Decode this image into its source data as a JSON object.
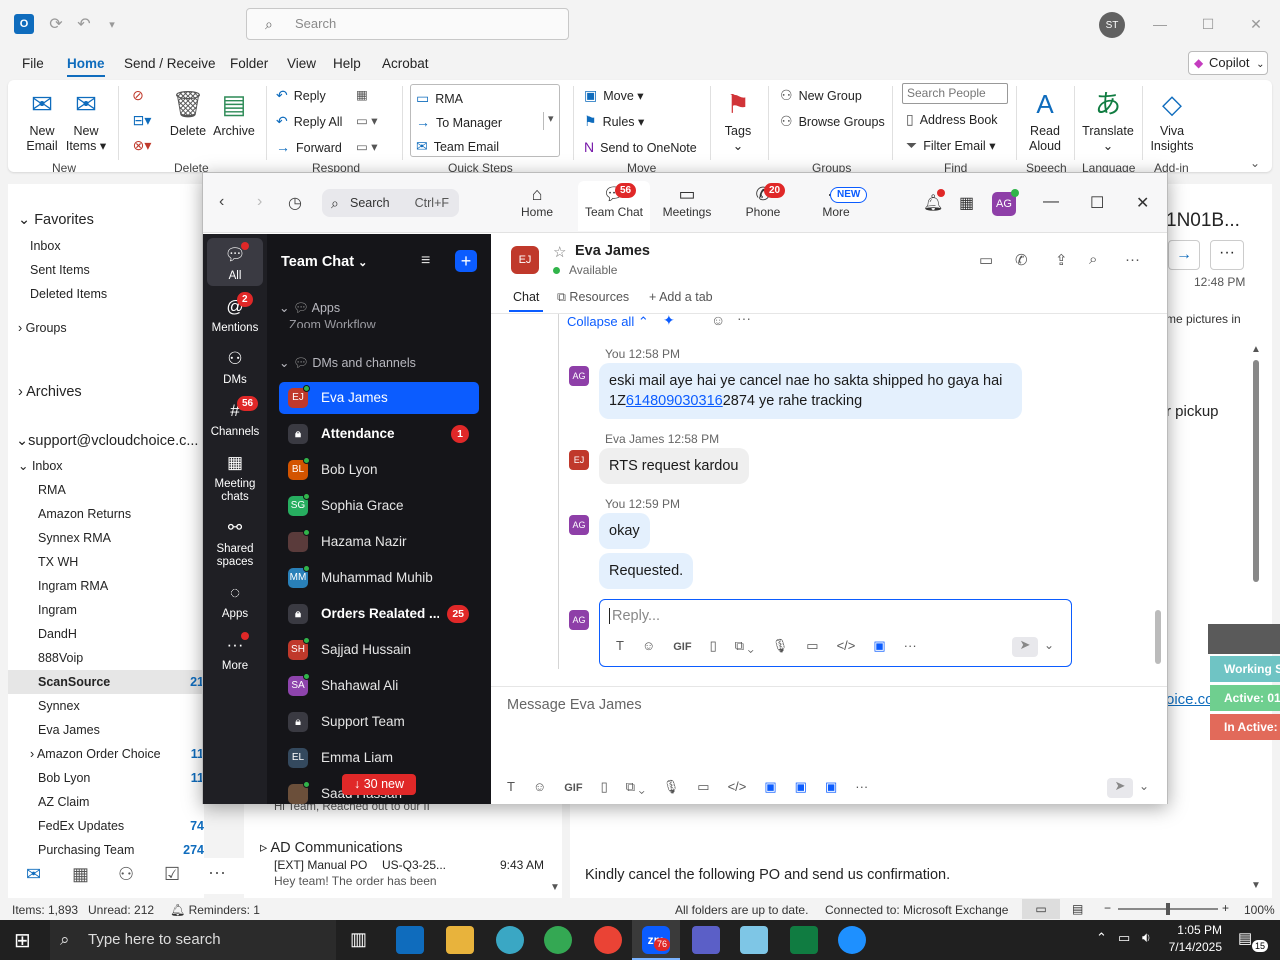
{
  "outlook": {
    "search_placeholder": "Search",
    "user_initials": "ST",
    "menu_tabs": [
      "File",
      "Home",
      "Send / Receive",
      "Folder",
      "View",
      "Help",
      "Acrobat"
    ],
    "copilot_label": "Copilot",
    "ribbon": {
      "new_email": [
        "New",
        "Email"
      ],
      "new_items": [
        "New",
        "Items"
      ],
      "delete": "Delete",
      "archive": "Archive",
      "reply": "Reply",
      "reply_all": "Reply All",
      "forward": "Forward",
      "qs_rma": "RMA",
      "qs_to_manager": "To Manager",
      "qs_team_email": "Team Email",
      "move": "Move",
      "rules": "Rules",
      "send_onenote": "Send to OneNote",
      "tags": "Tags",
      "new_group": "New Group",
      "browse_groups": "Browse Groups",
      "search_people": "Search People",
      "address_book": "Address Book",
      "filter_email": "Filter Email",
      "read_aloud": [
        "Read",
        "Aloud"
      ],
      "translate": "Translate",
      "viva": [
        "Viva",
        "Insights"
      ],
      "groups": [
        "New",
        "Delete",
        "Respond",
        "Quick Steps",
        "Move",
        "Groups",
        "Find",
        "Speech",
        "Language",
        "Add-in"
      ]
    },
    "folders": {
      "favorites": "Favorites",
      "fav_items": [
        "Inbox",
        "Sent Items",
        "Deleted Items"
      ],
      "groups": "Groups",
      "archives": "Archives",
      "account": "support@vcloudchoice.c...",
      "inbox": "Inbox",
      "inbox_items": [
        {
          "name": "RMA",
          "count": ""
        },
        {
          "name": "Amazon Returns",
          "count": ""
        },
        {
          "name": "Synnex RMA",
          "count": ""
        },
        {
          "name": "TX WH",
          "count": ""
        },
        {
          "name": "Ingram RMA",
          "count": ""
        },
        {
          "name": "Ingram",
          "count": ""
        },
        {
          "name": "DandH",
          "count": ""
        },
        {
          "name": "888Voip",
          "count": ""
        },
        {
          "name": "ScanSource",
          "count": "21"
        },
        {
          "name": "Synnex",
          "count": ""
        },
        {
          "name": "Eva James",
          "count": ""
        },
        {
          "name": "Amazon Order Choice",
          "count": "11"
        },
        {
          "name": "Bob Lyon",
          "count": "11"
        },
        {
          "name": "AZ Claim",
          "count": ""
        },
        {
          "name": "FedEx Updates",
          "count": "74"
        },
        {
          "name": "Purchasing Team",
          "count": "274"
        }
      ]
    },
    "message_list": {
      "preview1": "Hi Team,   Reached out to our II",
      "group": "AD Communications",
      "item2_subject": "[EXT] Manual PO",
      "item2_code": "US-Q3-25...",
      "item2_time": "9:43 AM",
      "item2_preview": "Hey team!  The order has been"
    },
    "reading": {
      "code_fragment": "1N01B...",
      "time": "12:48 PM",
      "pictures_note": "me pictures in",
      "pickup": "r pickup",
      "link_fragment": "oice.com",
      "body_fragment": "Kindly cancel the following PO and send us confirmation.",
      "status_working": "Working S",
      "status_active": "Active: 01",
      "status_inactive": "In Active:"
    },
    "status": {
      "items": "Items: 1,893",
      "unread": "Unread: 212",
      "reminders": "Reminders: 1",
      "sync": "All folders are up to date.",
      "connected": "Connected to: Microsoft Exchange",
      "zoom": "100%"
    }
  },
  "taskbar": {
    "search_placeholder": "Type here to search",
    "time": "1:05 PM",
    "date": "7/14/2025",
    "zoom_badge": "76",
    "notif_count": "15"
  },
  "zoom": {
    "search_label": "Search",
    "search_shortcut": "Ctrl+F",
    "tabs": [
      {
        "label": "Home",
        "badge": ""
      },
      {
        "label": "Team Chat",
        "badge": "56"
      },
      {
        "label": "Meetings",
        "badge": ""
      },
      {
        "label": "Phone",
        "badge": "20"
      },
      {
        "label": "More",
        "badge": "NEW"
      }
    ],
    "avatar_initials": "AG",
    "rail": [
      {
        "label": "All",
        "badge": ""
      },
      {
        "label": "Mentions",
        "badge": "2"
      },
      {
        "label": "DMs",
        "badge": ""
      },
      {
        "label": "Channels",
        "badge": "56"
      },
      {
        "label": "Meeting chats",
        "badge": ""
      },
      {
        "label": "Shared spaces",
        "badge": ""
      },
      {
        "label": "Apps",
        "badge": ""
      },
      {
        "label": "More",
        "badge": ""
      }
    ],
    "list_title": "Team Chat",
    "apps_section": "Apps",
    "apps_cut_item": "Zoom Workflow",
    "dm_section": "DMs and channels",
    "contacts": [
      {
        "initials": "EJ",
        "name": "Eva James",
        "color": "#c0392b",
        "count": "",
        "bold": false,
        "locked": false,
        "online": true
      },
      {
        "initials": "",
        "name": "Attendance",
        "color": "#3a3a42",
        "count": "1",
        "bold": true,
        "locked": true,
        "online": false
      },
      {
        "initials": "BL",
        "name": "Bob Lyon",
        "color": "#d35400",
        "count": "",
        "bold": false,
        "locked": false,
        "online": true
      },
      {
        "initials": "SG",
        "name": "Sophia Grace",
        "color": "#27ae60",
        "count": "",
        "bold": false,
        "locked": false,
        "online": true
      },
      {
        "initials": "",
        "name": "Hazama Nazir",
        "color": "#5a3b3b",
        "count": "",
        "bold": false,
        "locked": false,
        "online": true
      },
      {
        "initials": "MM",
        "name": "Muhammad Muhib",
        "color": "#2980b9",
        "count": "",
        "bold": false,
        "locked": false,
        "online": true
      },
      {
        "initials": "",
        "name": "Orders Realated ...",
        "color": "#3a3a42",
        "count": "25",
        "bold": true,
        "locked": true,
        "online": false
      },
      {
        "initials": "SH",
        "name": "Sajjad Hussain",
        "color": "#c0392b",
        "count": "",
        "bold": false,
        "locked": false,
        "online": true
      },
      {
        "initials": "SA",
        "name": "Shahawal Ali",
        "color": "#8e44ad",
        "count": "",
        "bold": false,
        "locked": false,
        "online": true
      },
      {
        "initials": "",
        "name": "Support Team",
        "color": "#3a3a42",
        "count": "",
        "bold": false,
        "locked": true,
        "online": false
      },
      {
        "initials": "EL",
        "name": "Emma Liam",
        "color": "#34495e",
        "count": "",
        "bold": false,
        "locked": false,
        "online": false
      },
      {
        "initials": "",
        "name": "Saad Hassan",
        "color": "#6b4f3a",
        "count": "",
        "bold": false,
        "locked": false,
        "online": true
      }
    ],
    "new_messages": "↓ 30 new",
    "chat": {
      "contact_initials": "EJ",
      "contact_name": "Eva James",
      "presence": "Available",
      "subtabs": [
        "Chat",
        "Resources",
        "Add a tab"
      ],
      "collapse_all": "Collapse all",
      "messages": [
        {
          "sender": "You",
          "time": "12:58 PM",
          "initials": "AG",
          "lines": [
            "eski mail aye hai ye cancel nae ho sakta shipped ho gaya hai"
          ],
          "pre": "1Z",
          "link": "614809030316",
          "post": "2874 ye rahe tracking"
        },
        {
          "sender": "Eva James",
          "time": "12:58 PM",
          "initials": "EJ",
          "text": "RTS request kardou"
        },
        {
          "sender": "You",
          "time": "12:59 PM",
          "initials": "AG",
          "text": "okay",
          "text2": "Requested."
        }
      ],
      "reply_placeholder": "Reply...",
      "reply_avatar": "AG",
      "compose_placeholder": "Message Eva James"
    }
  },
  "colors": {
    "zoom_blue": "#0b5cff",
    "outlook_blue": "#0f6cbd",
    "badge_red": "#e02828"
  }
}
